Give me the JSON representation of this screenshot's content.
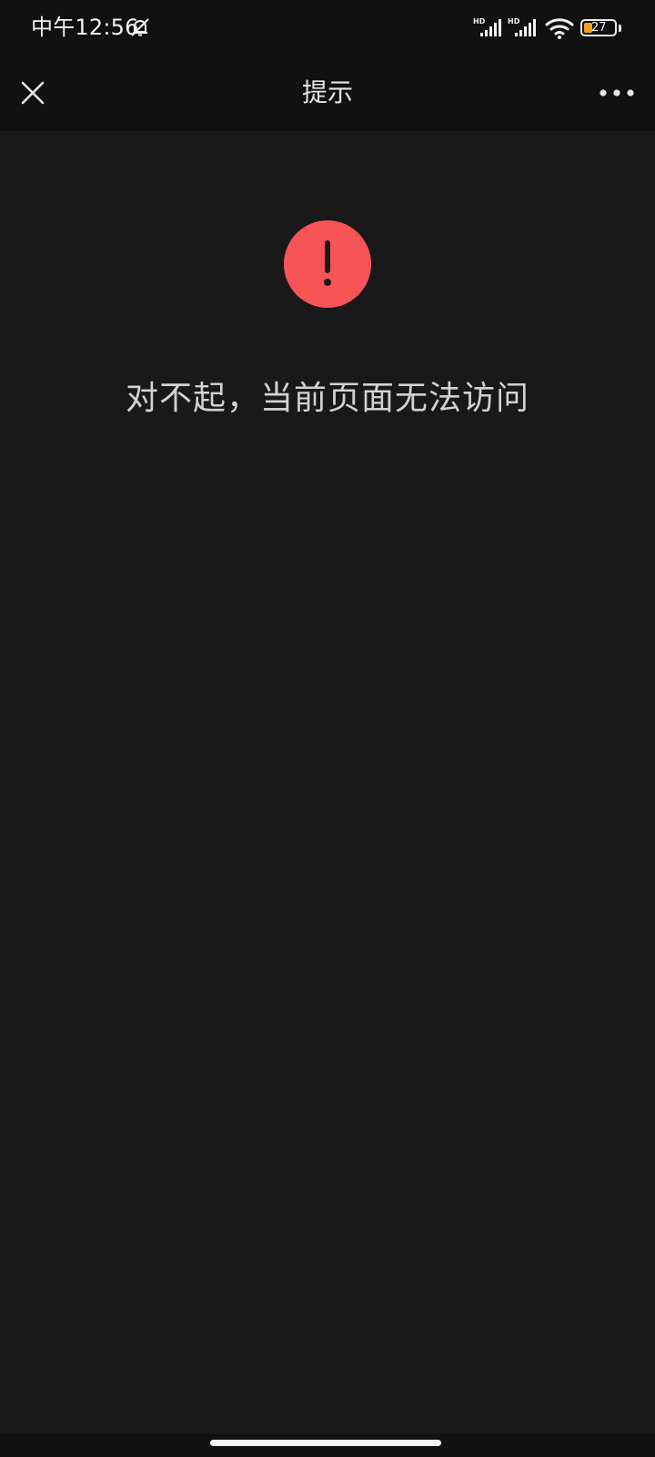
{
  "status_bar": {
    "time": "中午12:56",
    "icons": [
      "dnd-bell-off-icon",
      "hd-signal-icon",
      "hd-signal-icon",
      "wifi-icon",
      "battery-icon"
    ],
    "signal_label": "HD",
    "battery_level": "27"
  },
  "nav": {
    "close_icon": "close-icon",
    "title": "提示",
    "more_icon": "more-dots-icon"
  },
  "content": {
    "icon": "warning-exclamation-icon",
    "icon_color": "#f65456",
    "message": "对不起，当前页面无法访问"
  }
}
